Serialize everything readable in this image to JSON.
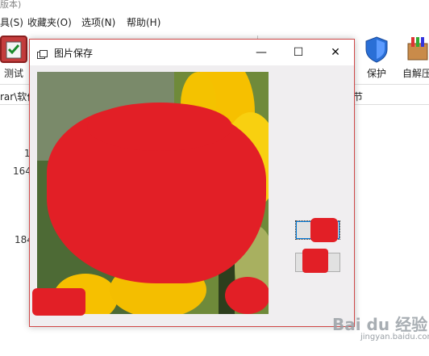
{
  "window": {
    "title_fragment": "版本)"
  },
  "menu": {
    "items": [
      "具(S)",
      "收藏夹(O)",
      "选项(N)",
      "帮助(H)"
    ]
  },
  "toolbar": {
    "left_button_label": "测试",
    "protect_label": "保护",
    "selfextract_label": "自解压"
  },
  "addressbar": {
    "left_text": "rar\\软件",
    "right_text": "节"
  },
  "list": {
    "num1": "1",
    "num2": "164",
    "num3": "184"
  },
  "dialog": {
    "title": "图片保存",
    "minimize_glyph": "—",
    "maximize_glyph": "☐",
    "close_glyph": "✕",
    "button_a_label": "",
    "button_b_label": ""
  },
  "watermark": {
    "text": "Bai du 经验",
    "sub": "jingyan.baidu.com"
  },
  "colors": {
    "accent_border": "#d04848",
    "redaction": "#e21f26",
    "sunflower_yellow": "#f6c000"
  }
}
